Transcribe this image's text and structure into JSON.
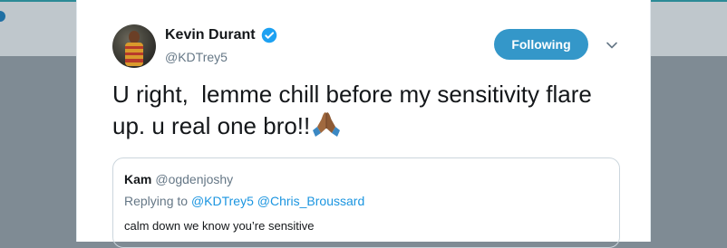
{
  "tweet": {
    "author": {
      "display_name": "Kevin Durant",
      "handle": "@KDTrey5",
      "verified": true
    },
    "follow_button": {
      "label": "Following"
    },
    "text": "U right,  lemme chill before my sensitivity flare up. u real one bro!!",
    "emoji": "folded-hands-icon",
    "quoted_tweet": {
      "author_name": "Kam",
      "author_handle": "@ogdenjoshy",
      "replying_label": "Replying to",
      "reply_to_1": "@KDTrey5",
      "reply_to_2": "@Chris_Broussard",
      "text": "calm down we know you’re sensitive"
    }
  },
  "colors": {
    "follow_button_bg": "#3497c9",
    "verified_badge": "#1da1f2",
    "link": "#1b95e0",
    "secondary_text": "#657786",
    "primary_text": "#14171a",
    "overlay_bg": "#7f8b94"
  }
}
